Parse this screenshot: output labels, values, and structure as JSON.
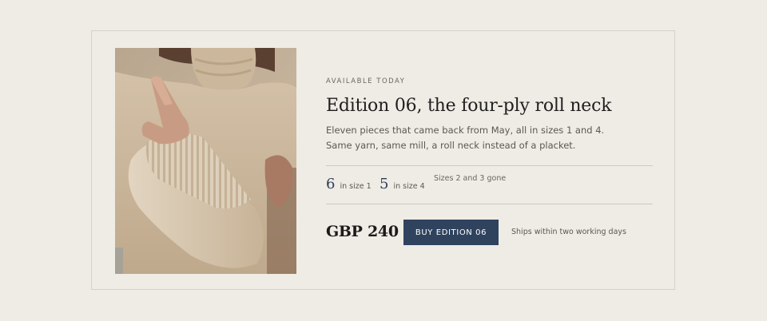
{
  "product": {
    "eyebrow": "AVAILABLE TODAY",
    "title": "Edition 06, the four-ply roll neck",
    "description_line1": "Eleven pieces that came back from May, all in sizes 1 and 4.",
    "description_line2": "Same yarn, same mill, a roll neck instead of a placket.",
    "image_alt": "Person wearing a beige ribbed knit roll neck sweater"
  },
  "stock": [
    {
      "count": "6",
      "label": "in size 1"
    },
    {
      "count": "5",
      "label": "in size 4"
    }
  ],
  "stock_note": "Sizes 2 and 3 gone",
  "purchase": {
    "price": "GBP 240",
    "buy_label": "BUY EDITION 06",
    "shipping_note": "Ships within two working days"
  },
  "colors": {
    "page_background": "#efebe5",
    "accent": "#2f435e",
    "stat_number": "#2e3e56",
    "sweater": "#c9b49a"
  }
}
